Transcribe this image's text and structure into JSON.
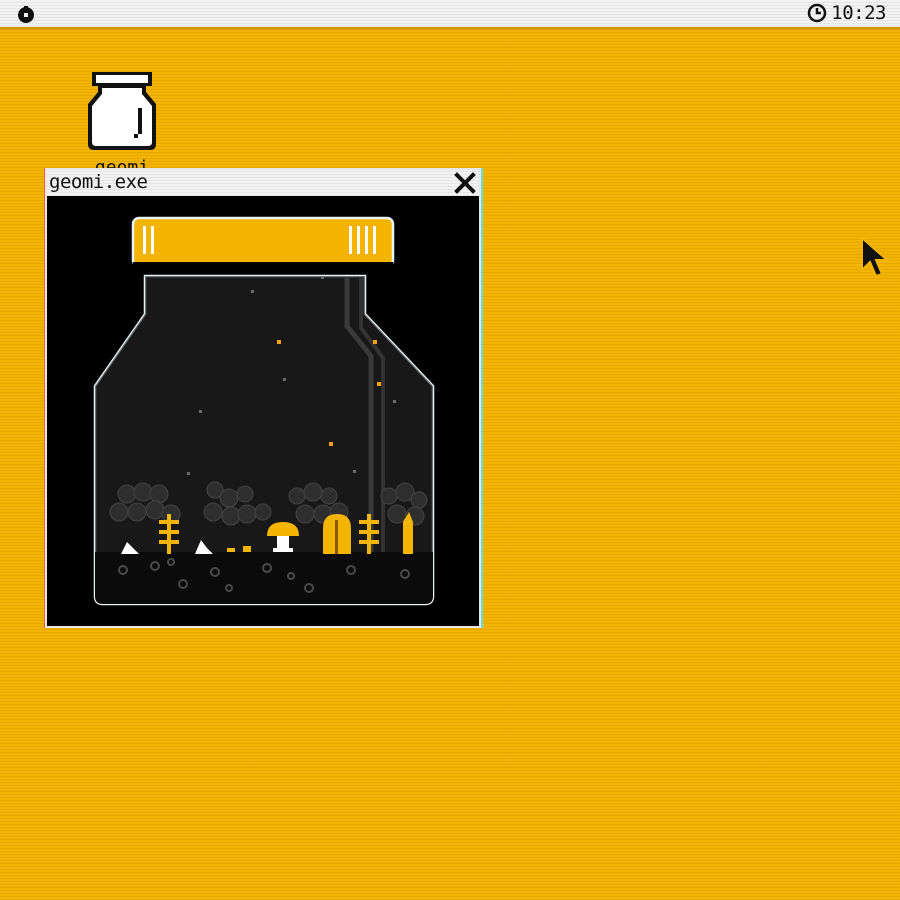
{
  "menubar": {
    "logo_icon": "pumpkin-logo-icon",
    "clock_icon": "clock-icon",
    "time": "10:23"
  },
  "desktop": {
    "icons": [
      {
        "label": "geomi",
        "icon": "jar-icon"
      }
    ]
  },
  "window": {
    "title": "geomi.exe",
    "close_icon": "close-x-icon"
  },
  "scene": {
    "lid_color": "#f5b400",
    "glass_outline_color": "#e8f4f4",
    "sprout_color": "#f5b400",
    "firefly_color": "#f5a000"
  },
  "cursor": "arrow-cursor-icon"
}
